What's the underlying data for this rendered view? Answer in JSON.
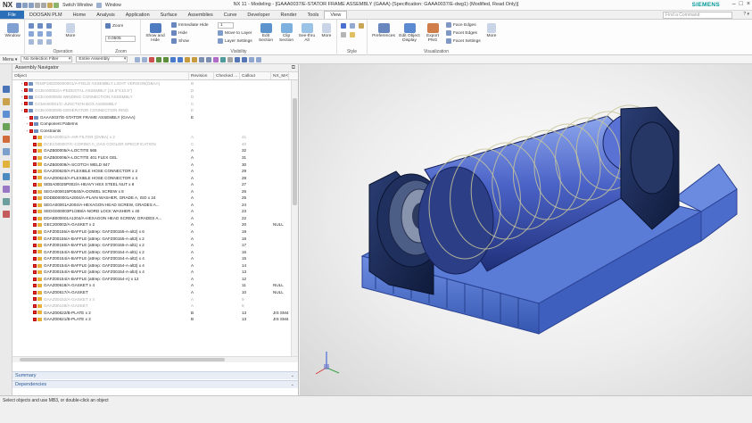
{
  "titlebar": {
    "app_logo": "NX",
    "quick_access": [
      "Switch Window",
      "Window"
    ],
    "title": "NX 11 - Modeling - [GAAA0037/E-STATOR FRAME ASSEMBLY (GAAA) (Specification: GAAA0037/E-dwg1) (Modified, Read Only)]",
    "brand": "SIEMENS",
    "window_controls": [
      "–",
      "□",
      "×"
    ]
  },
  "menubar": {
    "items": [
      "File",
      "DOOSAN PLM",
      "Home",
      "Analysis",
      "Application",
      "Surface",
      "Assemblies",
      "Curve",
      "Developer",
      "Render",
      "Tools",
      "View"
    ],
    "active": "View",
    "command_finder_placeholder": "Find a Command"
  },
  "ribbon": {
    "window_label": "Window",
    "operation": {
      "label": "Operation",
      "more": "More"
    },
    "zoom": {
      "label": "Zoom",
      "zoom_btn": "Zoom",
      "zoom_value": "0.0505"
    },
    "visibility": {
      "label": "Visibility",
      "show_hide": "Show and Hide",
      "immediate_hide": "Immediate Hide",
      "hide": "Hide",
      "show": "Show",
      "layer_value": "1",
      "move_to_layer": "Move to Layer",
      "layer_settings": "Layer Settings",
      "edit_section": "Edit Section",
      "clip_section": "Clip Section",
      "see_thru": "See-thru All",
      "more": "More"
    },
    "style": {
      "label": "Style"
    },
    "visualization": {
      "label": "Visualization",
      "preferences": "Preferences",
      "edit_object_display": "Edit Object Display",
      "export_png": "Export PNG",
      "face_edges": "Face Edges",
      "facet_edges": "Facet Edges",
      "facet_settings": "Facet Settings",
      "more": "More"
    }
  },
  "filterbar": {
    "menu": "Menu ▾",
    "selection_filter": "No Selection Filter",
    "scope": "Entire Assembly"
  },
  "navigator": {
    "title": "Assembly Navigator",
    "columns": [
      "Object",
      "Revision",
      "Checked ...",
      "Callout",
      "NX_MAT..."
    ],
    "rows": [
      {
        "name": "TEMP180200000001/A-FIELD ASSEMBLY LIGHT VERSION(GBAA)",
        "rev": "B",
        "chk": "",
        "call": "",
        "nx": "",
        "dim": true,
        "tw": "+",
        "grp": true
      },
      {
        "name": "GCBA00002/A-PEDESTAL ASSEMBLY (15.5\"X10.5\")",
        "rev": "D",
        "chk": "",
        "call": "",
        "nx": "",
        "dim": true,
        "tw": "+",
        "grp": true
      },
      {
        "name": "GCEA00005/B-WINDING CONNECTION ASSEMBLY",
        "rev": "D",
        "chk": "",
        "call": "",
        "nx": "",
        "dim": true,
        "tw": "+",
        "grp": true
      },
      {
        "name": "GCMA00001/C-JUNCTION BOX ASSEMBLY",
        "rev": "C",
        "chk": "",
        "call": "",
        "nx": "",
        "dim": true,
        "tw": "+",
        "grp": true
      },
      {
        "name": "GCBA00009/B-GENERATOR CONNECTION RING",
        "rev": "E",
        "chk": "",
        "call": "",
        "nx": "",
        "dim": true,
        "tw": "+",
        "grp": true
      },
      {
        "name": "GAAA0037/E-STATOR FRAME ASSEMBLY (GAAA)",
        "rev": "E",
        "chk": "",
        "call": "",
        "nx": "",
        "dim": false,
        "tw": "−",
        "grp": true
      },
      {
        "name": "Component Patterns",
        "rev": "",
        "chk": "",
        "call": "",
        "nx": "",
        "dim": false,
        "tw": "+",
        "grp": true
      },
      {
        "name": "Constraints",
        "rev": "",
        "chk": "",
        "call": "",
        "nx": "",
        "dim": false,
        "tw": "+",
        "grp": true
      },
      {
        "name": "DVBA00001/A-AIR FILTER (DVBA) x 2",
        "rev": "A",
        "chk": "",
        "call": "41",
        "nx": "",
        "dim": true,
        "tw": "",
        "grp": false
      },
      {
        "name": "DCEC000007/C-CORING II_GAS COOLER SPECIFICATION",
        "rev": "C",
        "chk": "",
        "call": "40",
        "nx": "",
        "dim": true,
        "tw": "",
        "grp": false
      },
      {
        "name": "GAZB00005/A-LOCTITE 565",
        "rev": "A",
        "chk": "",
        "call": "32",
        "nx": "",
        "dim": false,
        "tw": "",
        "grp": false
      },
      {
        "name": "GAZB00006/A-LOCTITE 401 FLEX GEL",
        "rev": "A",
        "chk": "",
        "call": "31",
        "nx": "",
        "dim": false,
        "tw": "",
        "grp": false
      },
      {
        "name": "GAZB00009/A-SCOTCH WELD 847",
        "rev": "A",
        "chk": "",
        "call": "30",
        "nx": "",
        "dim": false,
        "tw": "",
        "grp": false
      },
      {
        "name": "GAAZ00620/A-FLEXIBLE HOSE CONNECTOR x 2",
        "rev": "A",
        "chk": "",
        "call": "29",
        "nx": "",
        "dim": false,
        "tw": "",
        "grp": false
      },
      {
        "name": "GAAZ00624/A-FLEXIBLE HOSE CONNECTOR x 4",
        "rev": "A",
        "chk": "",
        "call": "28",
        "nx": "",
        "dim": false,
        "tw": "",
        "grp": false
      },
      {
        "name": "SEBA00025P002/A-HEAVY HEX STEEL NUT x 8",
        "rev": "A",
        "chk": "",
        "call": "27",
        "nx": "",
        "dim": false,
        "tw": "",
        "grp": false
      },
      {
        "name": "SEGA000015P0540/A-DOWEL SCREW x 8",
        "rev": "A",
        "chk": "",
        "call": "26",
        "nx": "",
        "dim": false,
        "tw": "",
        "grp": false
      },
      {
        "name": "DDDB000001A2004/A-PLAIN WASHER, GRADE A, ISO x 24",
        "rev": "A",
        "chk": "",
        "call": "25",
        "nx": "",
        "dim": false,
        "tw": "",
        "grp": false
      },
      {
        "name": "SEGA00001A2004/A-HEXAGON HEAD SCREW, GRADES A...",
        "rev": "A",
        "chk": "",
        "call": "24",
        "nx": "",
        "dim": false,
        "tw": "",
        "grp": false
      },
      {
        "name": "SEDG000003P1/288/A-NORD LOCK WASHER x 40",
        "rev": "A",
        "chk": "",
        "call": "23",
        "nx": "",
        "dim": false,
        "tw": "",
        "grp": false
      },
      {
        "name": "DDAB000001A1204/A-HEXAGON HEAD SCREW, GRADES A...",
        "rev": "A",
        "chk": "",
        "call": "22",
        "nx": "",
        "dim": false,
        "tw": "",
        "grp": false
      },
      {
        "name": "GEC200002/A-GASKET x 2",
        "rev": "A",
        "chk": "",
        "call": "20",
        "nx": "NULL",
        "dim": false,
        "tw": "",
        "grp": false
      },
      {
        "name": "GAFZ00155/A-BAFFLE (attrep: GAFZ00155-A-alt2) x 6",
        "rev": "A",
        "chk": "",
        "call": "19",
        "nx": "",
        "dim": false,
        "tw": "",
        "grp": false
      },
      {
        "name": "GAFZ00155/A-BAFFLE (attrep: GAFZ00155-A-alt3) x 2",
        "rev": "A",
        "chk": "",
        "call": "18",
        "nx": "",
        "dim": false,
        "tw": "",
        "grp": false
      },
      {
        "name": "GAFZ00155/A-BAFFLE (attrep: GAFZ00155-A-alt1) x 2",
        "rev": "A",
        "chk": "",
        "call": "17",
        "nx": "",
        "dim": false,
        "tw": "",
        "grp": false
      },
      {
        "name": "GAFZ00154/A-BAFFLE (attrep: GAFZ00154-A-alt1) x 2",
        "rev": "A",
        "chk": "",
        "call": "16",
        "nx": "",
        "dim": false,
        "tw": "",
        "grp": false
      },
      {
        "name": "GAFZ00154/A-BAFFLE (attrep: GAFZ00154-A-alt2) x 4",
        "rev": "A",
        "chk": "",
        "call": "15",
        "nx": "",
        "dim": false,
        "tw": "",
        "grp": false
      },
      {
        "name": "GAFZ00154/A-BAFFLE (attrep: GAFZ00154-A-alt3) x 4",
        "rev": "A",
        "chk": "",
        "call": "14",
        "nx": "",
        "dim": false,
        "tw": "",
        "grp": false
      },
      {
        "name": "GAFZ00154/A-BAFFLE (attrep: GAFZ00154-A-alt4) x 4",
        "rev": "A",
        "chk": "",
        "call": "13",
        "nx": "",
        "dim": false,
        "tw": "",
        "grp": false
      },
      {
        "name": "GAFZ00154/A-BAFFLE (attrep: GAFZ00154-A) x 12",
        "rev": "A",
        "chk": "",
        "call": "12",
        "nx": "",
        "dim": false,
        "tw": "",
        "grp": false
      },
      {
        "name": "GAAZ00618/A-GASKET x 4",
        "rev": "A",
        "chk": "",
        "call": "11",
        "nx": "NULL",
        "dim": false,
        "tw": "",
        "grp": false
      },
      {
        "name": "GAAZ00617/A-GASKET",
        "rev": "A",
        "chk": "",
        "call": "10",
        "nx": "NULL",
        "dim": false,
        "tw": "",
        "grp": false
      },
      {
        "name": "GAAZ00152/A-GASKET x 4",
        "rev": "A",
        "chk": "",
        "call": "9",
        "nx": "",
        "dim": true,
        "tw": "",
        "grp": false
      },
      {
        "name": "GAAZ00149/A-GASKET",
        "rev": "A",
        "chk": "",
        "call": "8",
        "nx": "",
        "dim": true,
        "tw": "",
        "grp": false
      },
      {
        "name": "GAAZ00622/B-PLATE x 2",
        "rev": "B",
        "chk": "",
        "call": "13",
        "nx": "JIS SM4...",
        "dim": false,
        "tw": "",
        "grp": false
      },
      {
        "name": "GAAZ00621/B-PLATE x 2",
        "rev": "B",
        "chk": "",
        "call": "13",
        "nx": "JIS SM4...",
        "dim": false,
        "tw": "",
        "grp": false
      }
    ],
    "summary": "Summary",
    "dependencies": "Dependencies"
  },
  "status": {
    "message": "Select objects and use MB3, or double-click an object"
  },
  "colors": {
    "accent": "#2a6fb7",
    "model_blue": "#4a6fd0",
    "model_dark": "#1c2d55",
    "brand": "#009999"
  }
}
